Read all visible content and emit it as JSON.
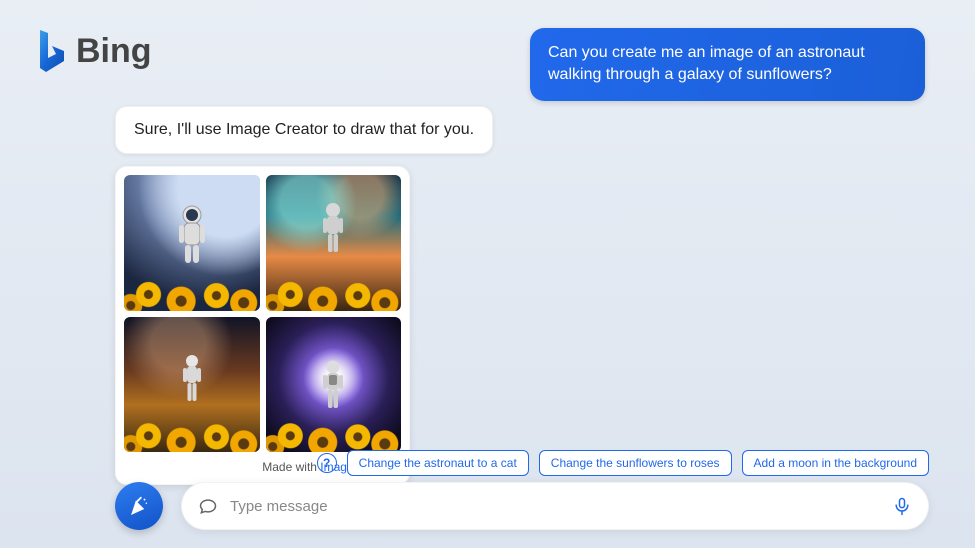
{
  "brand": {
    "name": "Bing"
  },
  "user_message": "Can you create me an image of an astronaut walking through a galaxy of sunflowers?",
  "assistant_message": "Sure, I'll use Image Creator to draw that for you.",
  "attribution": {
    "prefix": "Made with ",
    "link_text": "Image Creator"
  },
  "help_label": "?",
  "suggestions": [
    "Change the astronaut to a cat",
    "Change the sunflowers to roses",
    "Add a moon in the background"
  ],
  "composer": {
    "placeholder": "Type message"
  }
}
